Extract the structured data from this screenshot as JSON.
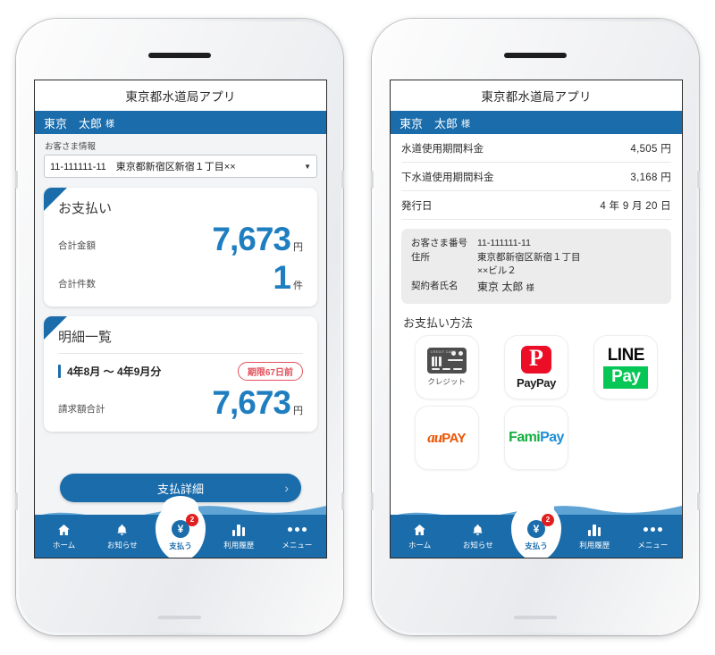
{
  "app": {
    "title": "東京都水道局アプリ",
    "user_name": "東京　太郎",
    "user_suffix": "様"
  },
  "left_screen": {
    "customer_label": "お客さま情報",
    "customer_select_value": "11-111111-11　東京都新宿区新宿１丁目××",
    "payment_card": {
      "title": "お支払い",
      "total_amount_label": "合計金額",
      "total_amount_value": "7,673",
      "total_amount_unit": "円",
      "total_count_label": "合計件数",
      "total_count_value": "1",
      "total_count_unit": "件"
    },
    "detail_card": {
      "title": "明細一覧",
      "period": "4年8月 ～ 4年9月分",
      "due_badge": "期限67日前",
      "billed_label": "請求額合計",
      "billed_value": "7,673",
      "billed_unit": "円"
    },
    "pay_button": {
      "label": "支払詳細",
      "chevron": "›"
    }
  },
  "right_screen": {
    "fees": [
      {
        "label": "水道使用期間料金",
        "value": "4,505 円"
      },
      {
        "label": "下水道使用期間料金",
        "value": "3,168 円"
      },
      {
        "label": "発行日",
        "value": "4 年 9 月 20 日"
      }
    ],
    "info": {
      "customer_no_label": "お客さま番号",
      "customer_no_value": "11-111111-11",
      "address_label": "住所",
      "address_line1": "東京都新宿区新宿１丁目",
      "address_line2": "××ビル２",
      "contractor_label": "契約者氏名",
      "contractor_value": "東京 太郎",
      "contractor_suffix": "様"
    },
    "payment_methods": {
      "title": "お支払い方法",
      "tiles": [
        {
          "name": "credit",
          "caption": "クレジット",
          "card_text": "CREDIT CARD"
        },
        {
          "name": "paypay",
          "glyph": "P",
          "word": "PayPay"
        },
        {
          "name": "linepay",
          "top": "LINE",
          "bottom": "Pay"
        },
        {
          "name": "aupay",
          "left": "au",
          "right": "PAY"
        },
        {
          "name": "famipay",
          "left": "Fami",
          "right": "Pay"
        }
      ]
    }
  },
  "bottom_nav": {
    "items": [
      {
        "label": "ホーム",
        "icon": "home-icon"
      },
      {
        "label": "お知らせ",
        "icon": "bell-icon"
      },
      {
        "label": "支払う",
        "icon": "yen-icon",
        "badge": "2"
      },
      {
        "label": "利用履歴",
        "icon": "bar-chart-icon"
      },
      {
        "label": "メニュー",
        "icon": "ellipsis-icon"
      }
    ]
  },
  "colors": {
    "brand_blue": "#1a6cab",
    "accent_blue": "#1f7ec0",
    "alert_red": "#e2515c",
    "badge_red": "#e02020",
    "line_green": "#06c755",
    "paypay_red": "#ec0e27",
    "au_orange": "#eb5505",
    "fami_green": "#15ae3f",
    "fami_blue": "#1d8fd6"
  }
}
